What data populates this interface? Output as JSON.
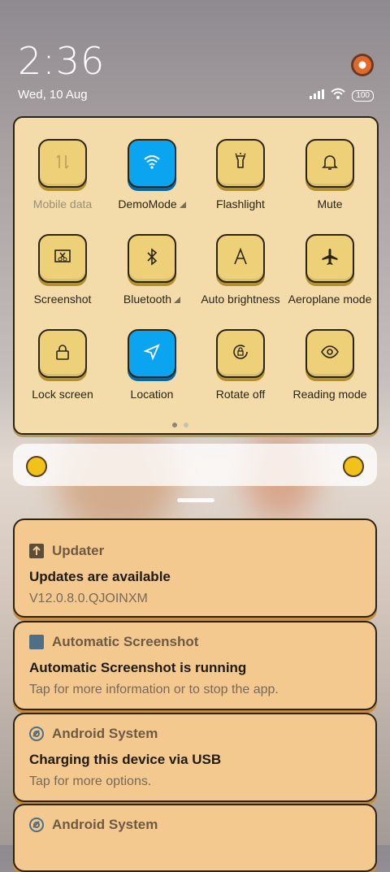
{
  "status": {
    "time": "2:36",
    "date": "Wed, 10 Aug",
    "battery": "100",
    "icons": [
      "signal-icon",
      "wifi-icon",
      "battery-icon"
    ]
  },
  "quick_settings": {
    "tiles": [
      {
        "label": "Mobile data",
        "icon": "mobile-data-icon",
        "active": false,
        "disabled": true
      },
      {
        "label": "DemoMode",
        "icon": "wifi-icon",
        "active": true,
        "expand": true
      },
      {
        "label": "Flashlight",
        "icon": "flashlight-icon",
        "active": false
      },
      {
        "label": "Mute",
        "icon": "bell-icon",
        "active": false
      },
      {
        "label": "Screenshot",
        "icon": "screenshot-icon",
        "active": false
      },
      {
        "label": "Bluetooth",
        "icon": "bluetooth-icon",
        "active": false,
        "expand": true
      },
      {
        "label": "Auto brightness",
        "icon": "auto-brightness-icon",
        "active": false
      },
      {
        "label": "Aeroplane mode",
        "icon": "airplane-icon",
        "active": false
      },
      {
        "label": "Lock screen",
        "icon": "lock-icon",
        "active": false
      },
      {
        "label": "Location",
        "icon": "location-icon",
        "active": true
      },
      {
        "label": "Rotate off",
        "icon": "rotate-lock-icon",
        "active": false
      },
      {
        "label": "Reading mode",
        "icon": "eye-icon",
        "active": false
      }
    ],
    "page_count": 2,
    "current_page": 1
  },
  "notifications": [
    {
      "app": "Updater",
      "icon": "upload-icon",
      "title": "Updates are available",
      "body": "V12.0.8.0.QJOINXM"
    },
    {
      "app": "Automatic Screenshot",
      "icon": "app-square-icon",
      "title": "Automatic Screenshot is running",
      "body": "Tap for more information or to stop the app."
    },
    {
      "app": "Android System",
      "icon": "android-system-icon",
      "title": "Charging this device via USB",
      "body": "Tap for more options."
    },
    {
      "app": "Android System",
      "icon": "android-system-icon",
      "title": "",
      "body": ""
    }
  ],
  "colors": {
    "accent": "#0aa4f0",
    "tile": "#edd078",
    "panel": "#f3dcaa",
    "notification": "#f4c98f"
  }
}
